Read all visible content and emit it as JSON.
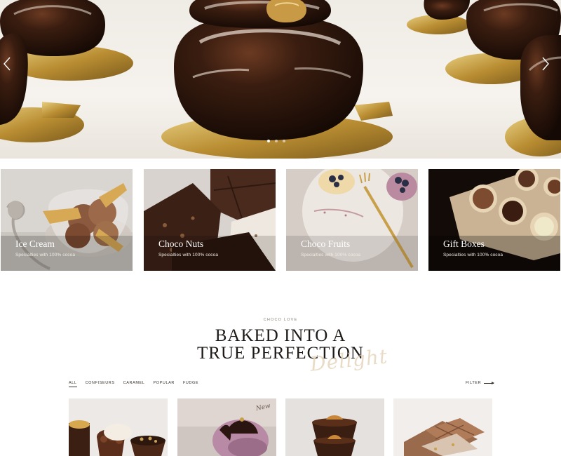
{
  "hero": {
    "prev_icon": "chevron-left-icon",
    "next_icon": "chevron-right-icon",
    "slide_count": 3,
    "active_slide": 1
  },
  "categories": [
    {
      "title": "Ice Cream",
      "subtitle": "Specialties with 100% cocoa"
    },
    {
      "title": "Choco Nuts",
      "subtitle": "Specialties with 100% cocoa"
    },
    {
      "title": "Choco Fruits",
      "subtitle": "Specialties with 100% cocoa"
    },
    {
      "title": "Gift Boxes",
      "subtitle": "Specialties with 100% cocoa"
    }
  ],
  "section": {
    "eyebrow": "CHOCO LOVE",
    "headline_line1": "BAKED INTO A",
    "headline_line2": "TRUE PERFECTION",
    "script_word": "Delight"
  },
  "filters": {
    "items": [
      "ALL",
      "CONFISEURS",
      "CARAMEL",
      "POPULAR",
      "FUDGE"
    ],
    "active": "ALL",
    "toggle_label": "FILTER",
    "toggle_icon": "arrow-right-icon"
  },
  "products": {
    "badge": "New"
  },
  "colors": {
    "chocolate": "#2a160d",
    "gold": "#c9a44a",
    "cream": "#f3efe9",
    "script_gold": "#e6d6bd"
  }
}
